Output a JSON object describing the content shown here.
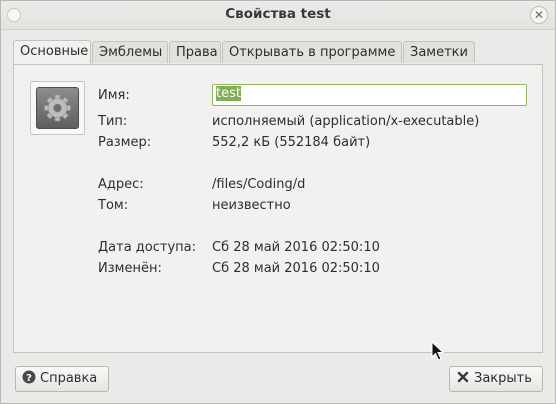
{
  "window": {
    "title": "Свойства test"
  },
  "tabs": [
    {
      "label": "Основные",
      "active": true
    },
    {
      "label": "Эмблемы"
    },
    {
      "label": "Права"
    },
    {
      "label": "Открывать в программе"
    },
    {
      "label": "Заметки"
    }
  ],
  "icon": "executable-gear-icon",
  "fields": {
    "name_label": "Имя:",
    "name_value": "test",
    "type_label": "Тип:",
    "type_value": "исполняемый (application/x-executable)",
    "size_label": "Размер:",
    "size_value": "552,2 кБ (552184 байт)",
    "location_label": "Адрес:",
    "location_value": "/files/Coding/d",
    "volume_label": "Том:",
    "volume_value": "неизвестно",
    "accessed_label": "Дата доступа:",
    "accessed_value": "Сб 28 май 2016 02:50:10",
    "modified_label": "Изменён:",
    "modified_value": "Сб 28 май 2016 02:50:10"
  },
  "buttons": {
    "help": "Справка",
    "close": "Закрыть"
  },
  "colors": {
    "selection": "#7fae55",
    "focus_border": "#8cb860"
  }
}
